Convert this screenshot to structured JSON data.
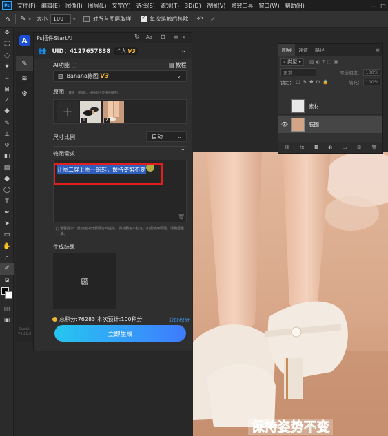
{
  "menubar": {
    "logo": "Ps",
    "items": [
      "文件(F)",
      "编辑(E)",
      "图像(I)",
      "图层(L)",
      "文字(Y)",
      "选择(S)",
      "滤镜(T)",
      "3D(D)",
      "视图(V)",
      "增效工具",
      "窗口(W)",
      "帮助(H)"
    ]
  },
  "optbar": {
    "size_label": "大小",
    "size_value": "109",
    "sample_all_label": "对所有图层取样",
    "remove_each_stroke_label": "每次笔触后移除"
  },
  "plugin": {
    "title": "Ps插件StartAI",
    "uid": "UID：4127657838",
    "account_type": "个人",
    "account_badge": "V3",
    "ai_function_label": "AI功能",
    "tutorial_label": "教程",
    "function_value": "Banana修图",
    "function_badge": "V3",
    "original_label": "原图",
    "original_hint": "（最多上传5张，长按图片可拖拽排序）",
    "thumb1_index": "1",
    "thumb2_index": "2",
    "ratio_label": "尺寸比例",
    "ratio_value": "自动",
    "prompt_label": "修图需求",
    "prompt_text": "让图二穿上图一的鞋，保持姿势不变",
    "warning_text": "温馨提示：此功能由外部服务商提供，偶有服务不稳定。如遇使用问题，请稍后重试。",
    "result_label": "生成结果",
    "points_text": "总积分:76283 本次预计:100积分",
    "get_points_label": "获取积分",
    "generate_label": "立即生成",
    "brand_name": "StartAI",
    "brand_version": "V3.21.0"
  },
  "layers": {
    "tabs": [
      "图层",
      "通道",
      "路径"
    ],
    "kind_filter": "类型",
    "blend_mode": "正常",
    "opacity_label": "不透明度：",
    "opacity_value": "100%",
    "lock_label": "锁定：",
    "fill_label": "填充：",
    "fill_value": "100%",
    "items": [
      {
        "name": "素材"
      },
      {
        "name": "底图"
      }
    ]
  },
  "canvas": {
    "subtitle": "保持姿势不变"
  },
  "colors": {
    "accent_blue": "#31a8ff",
    "generate_gradient_start": "#26c6f0",
    "generate_gradient_end": "#3f7bff",
    "highlight_red": "#e01f1f",
    "badge_gold": "#f0b43a",
    "subtitle_green": "#2f8f3a"
  }
}
